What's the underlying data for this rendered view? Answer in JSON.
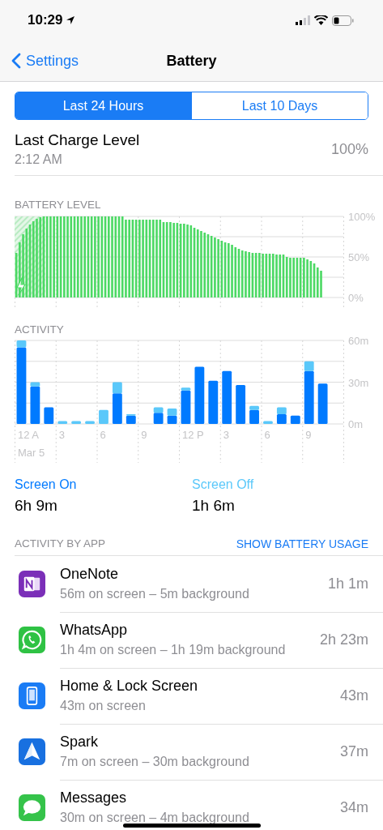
{
  "status_bar": {
    "time": "10:29"
  },
  "nav": {
    "back": "Settings",
    "title": "Battery"
  },
  "tabs": [
    {
      "label": "Last 24 Hours",
      "selected": true
    },
    {
      "label": "Last 10 Days",
      "selected": false
    }
  ],
  "last_charge": {
    "title": "Last Charge Level",
    "time": "2:12 AM",
    "value": "100%"
  },
  "battery_level": {
    "heading": "BATTERY LEVEL",
    "chart_data": {
      "type": "bar",
      "ylim": [
        0,
        100
      ],
      "yticks": [
        {
          "value": 0,
          "label": "0%"
        },
        {
          "value": 50,
          "label": "50%"
        },
        {
          "value": 100,
          "label": "100%"
        }
      ],
      "values": [
        55,
        68,
        78,
        85,
        90,
        94,
        97,
        99,
        100,
        100,
        100,
        100,
        100,
        100,
        100,
        100,
        100,
        100,
        100,
        100,
        100,
        100,
        100,
        100,
        100,
        100,
        100,
        100,
        100,
        100,
        100,
        100,
        96,
        96,
        96,
        96,
        96,
        96,
        96,
        96,
        96,
        96,
        96,
        93,
        93,
        93,
        92,
        92,
        91,
        91,
        90,
        89,
        86,
        84,
        82,
        80,
        78,
        76,
        74,
        72,
        70,
        68,
        67,
        65,
        62,
        60,
        58,
        57,
        56,
        55,
        55,
        55,
        54,
        54,
        54,
        54,
        53,
        53,
        53,
        50,
        49,
        49,
        49,
        49,
        49,
        47,
        45,
        42,
        37,
        33,
        null,
        null,
        null,
        null,
        null,
        null
      ],
      "grid": true
    },
    "charging": true
  },
  "activity": {
    "heading": "ACTIVITY",
    "hour_labels": [
      "12 A",
      "3",
      "6",
      "9",
      "12 P",
      "3",
      "6",
      "9"
    ],
    "date_label": "Mar 5",
    "chart_data": {
      "type": "bar",
      "stacked": true,
      "grid": true,
      "ylim": [
        0,
        60
      ],
      "yticks": [
        {
          "value": 0,
          "label": "0m"
        },
        {
          "value": 30,
          "label": "30m"
        },
        {
          "value": 60,
          "label": "60m"
        }
      ],
      "series": [
        {
          "name": "Screen On",
          "color": "#007aff",
          "values": [
            55,
            27,
            12,
            null,
            null,
            null,
            null,
            22,
            6,
            null,
            8,
            6,
            24,
            41,
            31,
            38,
            28,
            10,
            null,
            7,
            6,
            38,
            29,
            null
          ]
        },
        {
          "name": "Screen Off",
          "color": "#5ac8fa",
          "values": [
            5,
            3,
            null,
            2,
            2,
            2,
            10,
            8,
            1,
            null,
            4,
            5,
            2,
            null,
            null,
            null,
            null,
            3,
            2,
            5,
            null,
            7,
            null,
            null
          ]
        }
      ]
    }
  },
  "totals": [
    "6h 9m",
    "1h 6m"
  ],
  "apps_section": {
    "heading": "ACTIVITY BY APP",
    "action": "SHOW BATTERY USAGE"
  },
  "apps": [
    {
      "name": "OneNote",
      "detail": "56m on screen – 5m background",
      "total": "1h 1m",
      "kind": "notebook"
    },
    {
      "name": "WhatsApp",
      "detail": "1h 4m on screen – 1h 19m background",
      "total": "2h 23m",
      "kind": "phone-bubble"
    },
    {
      "name": "Home & Lock Screen",
      "detail": "43m on screen",
      "total": "43m",
      "kind": "phone"
    },
    {
      "name": "Spark",
      "detail": "7m on screen – 30m background",
      "total": "37m",
      "kind": "plane"
    },
    {
      "name": "Messages",
      "detail": "30m on screen – 4m background",
      "total": "34m",
      "kind": "bubble"
    }
  ]
}
